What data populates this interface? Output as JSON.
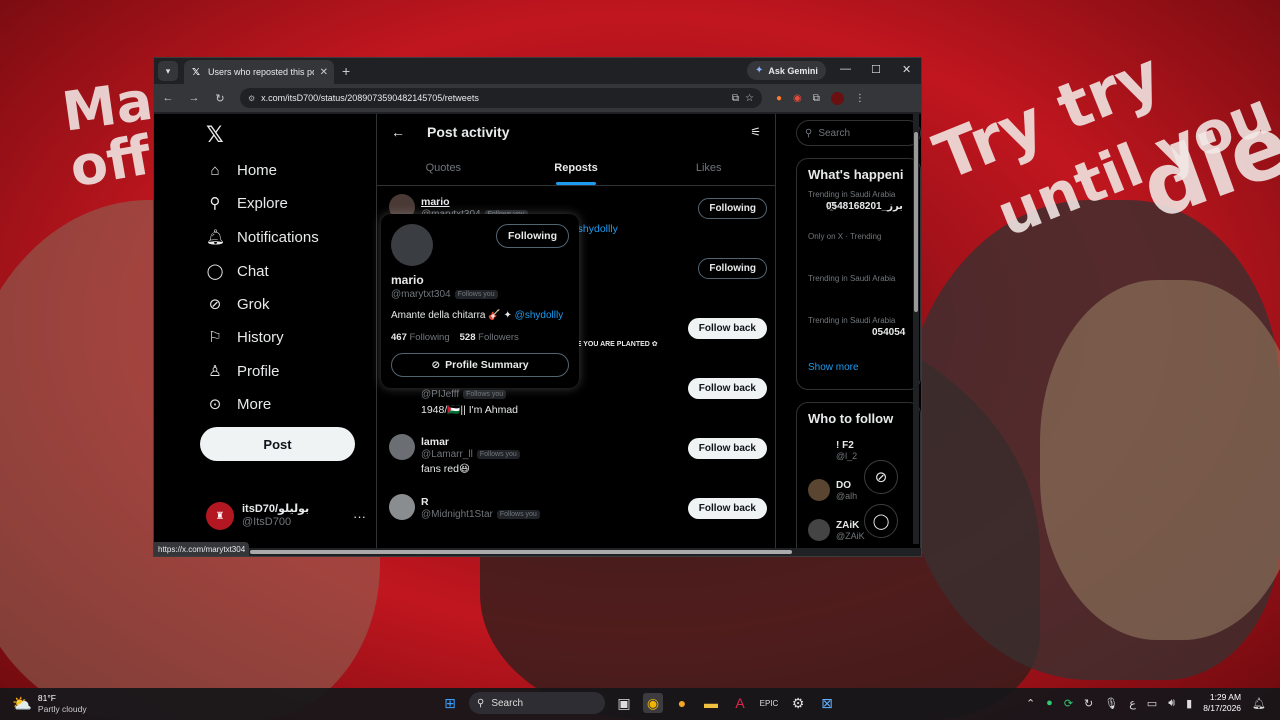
{
  "browser": {
    "tab_title": "Users who reposted this post / X",
    "gemini_label": "Ask Gemini",
    "url": "x.com/itsD700/status/2089073590482145705/retweets",
    "status_url": "https://x.com/marytxt304"
  },
  "nav": {
    "items": [
      {
        "label": "Home",
        "icon": "home-icon"
      },
      {
        "label": "Explore",
        "icon": "search-icon"
      },
      {
        "label": "Notifications",
        "icon": "bell-icon"
      },
      {
        "label": "Chat",
        "icon": "chat-icon"
      },
      {
        "label": "Grok",
        "icon": "grok-icon"
      },
      {
        "label": "History",
        "icon": "bookmark-icon"
      },
      {
        "label": "Profile",
        "icon": "person-icon"
      },
      {
        "label": "More",
        "icon": "more-circle-icon"
      }
    ],
    "post_label": "Post",
    "account": {
      "display_name": "itsD70/بوليلو",
      "handle": "@ItsD700"
    }
  },
  "main": {
    "title": "Post activity",
    "tabs": [
      "Quotes",
      "Reposts",
      "Likes"
    ],
    "active_tab": "Reposts",
    "rows": [
      {
        "name": "mario",
        "handle": "@marytxt304",
        "follows_you": "Follows you",
        "bio": "@shydollly",
        "button": "Following"
      },
      {
        "name": "",
        "handle": "",
        "follows_you": "",
        "bio": "",
        "button": "Following"
      },
      {
        "name": "",
        "handle": "",
        "follows_you": "",
        "bio": "ERE YOU ARE PLANTED ✿",
        "button": "Follow back"
      },
      {
        "name": "",
        "handle": "@PIJefff",
        "follows_you": "Follows you",
        "bio": "1948/🇵🇸|| I'm Ahmad",
        "button": "Follow back"
      },
      {
        "name": "lamar",
        "handle": "@Lamarr_ll",
        "follows_you": "Follows you",
        "bio": "fans red😆",
        "button": "Follow back"
      },
      {
        "name": "R",
        "handle": "@Midnight1Star",
        "follows_you": "Follows you",
        "bio": "",
        "button": "Follow back"
      }
    ]
  },
  "hovercard": {
    "name": "mario",
    "handle": "@marytxt304",
    "follows_you": "Follows you",
    "bio_text": "Amante della chitarra 🎸 ✦",
    "bio_link": "@shydollly",
    "following_count": "467",
    "following_label": "Following",
    "followers_count": "528",
    "followers_label": "Followers",
    "follow_button": "Following",
    "summary_button": "Profile Summary"
  },
  "right": {
    "search_placeholder": "Search",
    "happening_title": "What's happeni",
    "trends": [
      {
        "context": "Trending in Saudi Arabia",
        "name": "0҈548168201_برز"
      },
      {
        "context": "Only on X · Trending",
        "name": ""
      },
      {
        "context": "Trending in Saudi Arabia",
        "name": ""
      },
      {
        "context": "Trending in Saudi Arabia",
        "name": "054054"
      }
    ],
    "show_more": "Show more",
    "who_to_follow_title": "Who to follow",
    "suggestions": [
      {
        "name": "! F2",
        "handle": "@l_2"
      },
      {
        "name": "DO",
        "handle": "@alh"
      },
      {
        "name": "ZAiK",
        "handle": "@ZAiK"
      }
    ]
  },
  "taskbar": {
    "temp": "81°F",
    "condition": "Partly cloudy",
    "search_label": "Search",
    "time": "1:29 AM",
    "date": "8/17/2026",
    "lang": "ع"
  },
  "wallpaper": {
    "text_left_1": "Mask",
    "text_left_2": "off",
    "text_right_1": "Try try",
    "text_right_2": "until you",
    "text_right_3": "die!"
  }
}
